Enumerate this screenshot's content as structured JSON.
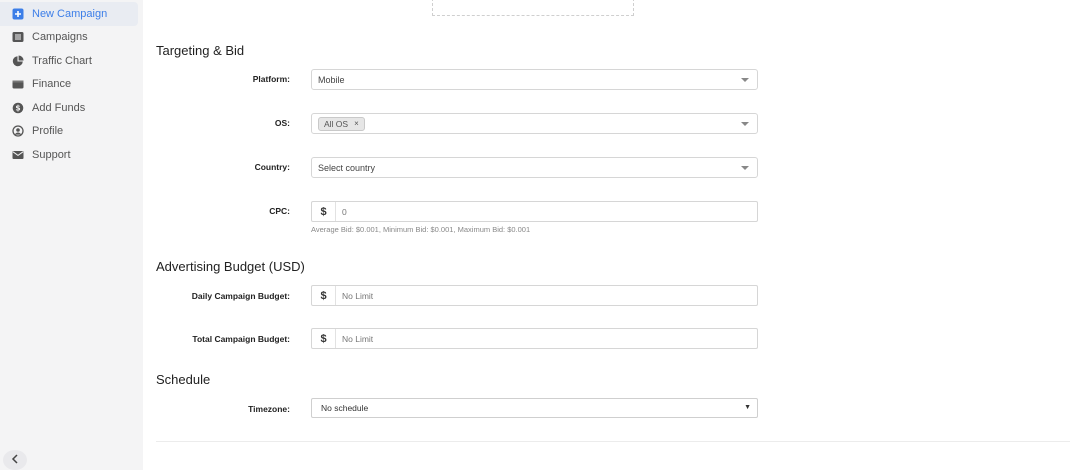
{
  "sidebar": {
    "items": [
      {
        "label": "New Campaign",
        "icon": "plus-square-icon"
      },
      {
        "label": "Campaigns",
        "icon": "list-icon"
      },
      {
        "label": "Traffic Chart",
        "icon": "pie-chart-icon"
      },
      {
        "label": "Finance",
        "icon": "wallet-icon"
      },
      {
        "label": "Add Funds",
        "icon": "money-icon"
      },
      {
        "label": "Profile",
        "icon": "user-circle-icon"
      },
      {
        "label": "Support",
        "icon": "envelope-icon"
      }
    ],
    "collapse_icon": "chevron-left-icon"
  },
  "targeting": {
    "title": "Targeting & Bid",
    "platform": {
      "label": "Platform:",
      "value": "Mobile"
    },
    "os": {
      "label": "OS:",
      "tag": "All OS",
      "tag_remove": "×"
    },
    "country": {
      "label": "Country:",
      "placeholder": "Select country"
    },
    "cpc": {
      "label": "CPC:",
      "currency": "$",
      "value": "0",
      "help": "Average Bid: $0.001, Minimum Bid: $0.001, Maximum Bid: $0.001"
    }
  },
  "budget": {
    "title": "Advertising Budget (USD)",
    "daily": {
      "label": "Daily Campaign Budget:",
      "currency": "$",
      "placeholder": "No Limit"
    },
    "total": {
      "label": "Total Campaign Budget:",
      "currency": "$",
      "placeholder": "No Limit"
    }
  },
  "schedule": {
    "title": "Schedule",
    "timezone": {
      "label": "Timezone:",
      "value": "No schedule",
      "arrow": "▼"
    }
  },
  "colors": {
    "accent": "#3c7ee8",
    "sidebar_bg": "#f4f4f5"
  }
}
